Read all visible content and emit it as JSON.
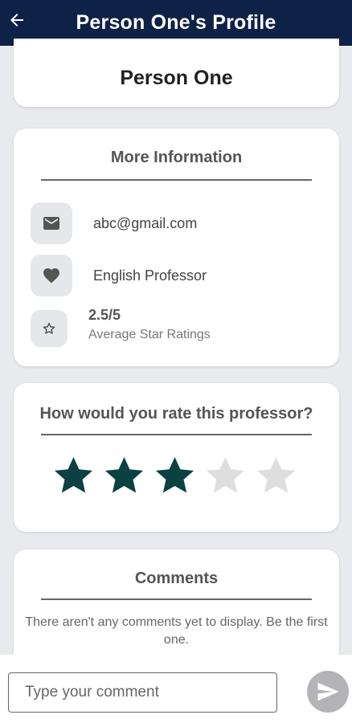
{
  "header": {
    "title": "Person One's Profile",
    "back_icon": "arrow-left-icon"
  },
  "profile": {
    "name": "Person One"
  },
  "info": {
    "title": "More Information",
    "email": "abc@gmail.com",
    "role": "English Professor",
    "rating_value": "2.5/5",
    "rating_label": "Average Star Ratings",
    "icons": [
      "mail-icon",
      "heart-icon",
      "star-outline-icon"
    ]
  },
  "rate": {
    "title": "How would you rate this professor?",
    "selected": 3,
    "max": 5,
    "filled_color": "#0c4142",
    "empty_color": "#dedede"
  },
  "comments": {
    "title": "Comments",
    "empty_text": "There aren't any comments yet to display. Be the first one."
  },
  "composer": {
    "placeholder": "Type your comment",
    "send_icon": "send-icon"
  },
  "colors": {
    "appbar": "#0e2247",
    "background": "#e9eaee",
    "send_button": "#b4b4b8"
  }
}
